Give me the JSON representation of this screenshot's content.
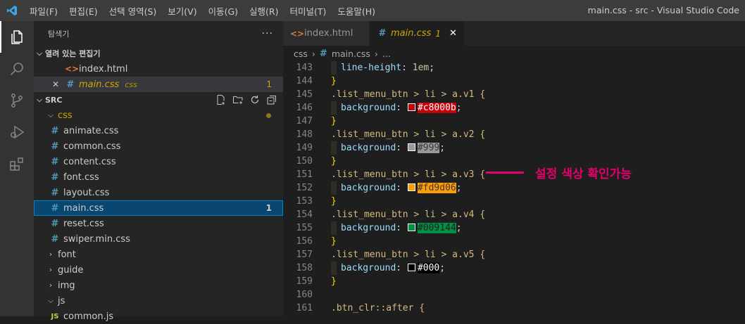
{
  "window": {
    "title": "main.css - src - Visual Studio Code",
    "menu": [
      "파일(F)",
      "편집(E)",
      "선택 영역(S)",
      "보기(V)",
      "이동(G)",
      "실행(R)",
      "터미널(T)",
      "도움말(H)"
    ]
  },
  "activity_bar": [
    "files-icon",
    "search-icon",
    "source-control-icon",
    "run-debug-icon",
    "extensions-icon"
  ],
  "sidebar": {
    "title": "탐색기",
    "more": "···",
    "open_editors": {
      "label": "열려 있는 편집기",
      "items": [
        {
          "name": "index.html",
          "icon": "html-icon"
        },
        {
          "name": "main.css",
          "folder": "css",
          "badge": "1",
          "close": "✕"
        }
      ]
    },
    "src": {
      "label": "SRC",
      "css_folder": "css",
      "css_files": [
        "animate.css",
        "common.css",
        "content.css",
        "font.css",
        "layout.css",
        "main.css",
        "reset.css",
        "swiper.min.css"
      ],
      "main_badge": "1",
      "folders": [
        "font",
        "guide",
        "img",
        "js"
      ],
      "js_file": "common.js"
    }
  },
  "tabs": [
    {
      "label": "index.html",
      "icon": "html-icon"
    },
    {
      "label": "main.css",
      "badge": "1",
      "close": "✕"
    }
  ],
  "breadcrumb": [
    "css",
    "main.css",
    "..."
  ],
  "code": {
    "line_numbers": [
      "143",
      "144",
      "145",
      "146",
      "147",
      "148",
      "149",
      "150",
      "151",
      "152",
      "153",
      "154",
      "155",
      "156",
      "157",
      "158",
      "159",
      "160",
      "161"
    ],
    "prop_lineheight": "line-height",
    "val_lineheight": "1em",
    "selectors": [
      ".list_menu_btn > li > a.v1 {",
      ".list_menu_btn > li > a.v2 {",
      ".list_menu_btn > li > a.v3 {",
      ".list_menu_btn > li > a.v4 {",
      ".list_menu_btn > li > a.v5 {"
    ],
    "prop_bg": "background",
    "colors": [
      "#c8000b",
      "#999",
      "#fd9d06",
      "#009144",
      "#000"
    ],
    "color_values": [
      "#c8000b",
      "#999999",
      "#fd9d06",
      "#009144",
      "#000000"
    ],
    "last_selector": ".btn_clr::after {",
    "close_brace": "}"
  },
  "annotation": {
    "text": "설정 색상 확인가능",
    "color": "#e5006d"
  }
}
